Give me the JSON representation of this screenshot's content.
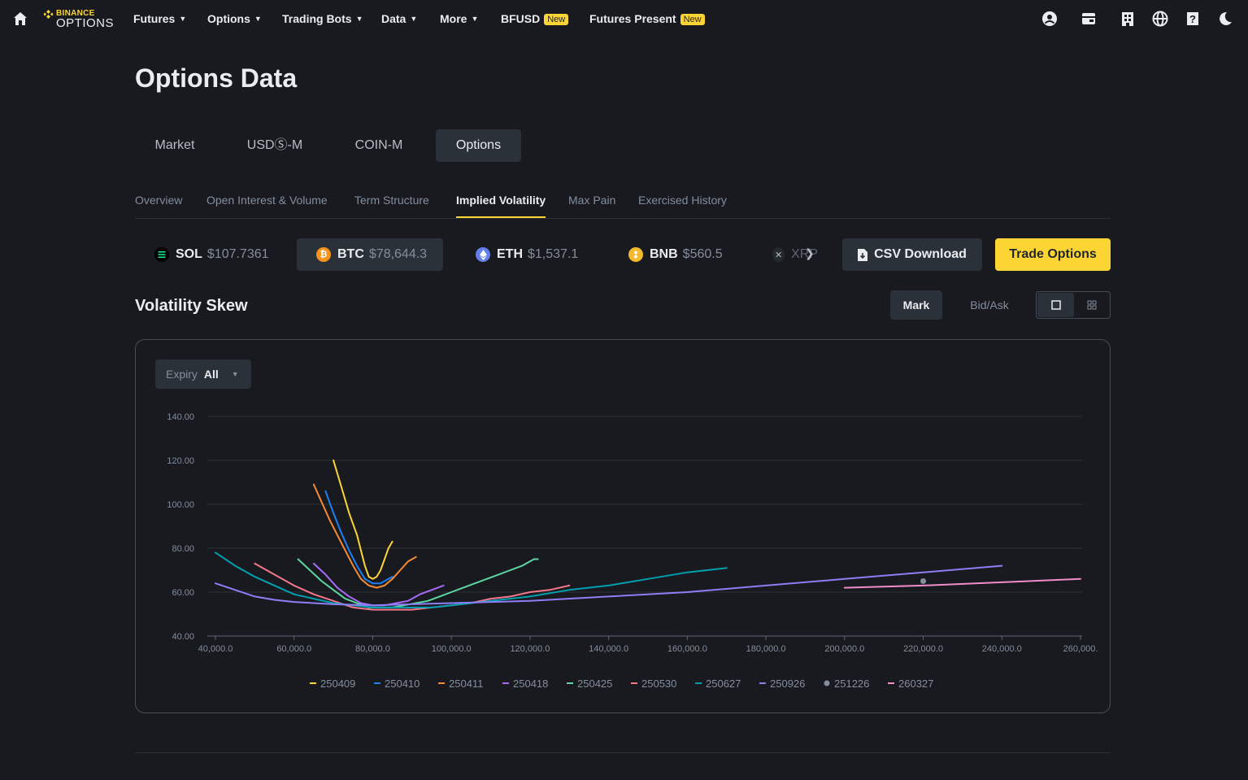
{
  "nav": {
    "logo_top": "BINANCE",
    "logo_bottom": "OPTIONS",
    "items": [
      {
        "label": "Futures",
        "dropdown": true,
        "badge": ""
      },
      {
        "label": "Options",
        "dropdown": true,
        "badge": ""
      },
      {
        "label": "Trading Bots",
        "dropdown": true,
        "badge": ""
      },
      {
        "label": "Data",
        "dropdown": true,
        "badge": ""
      },
      {
        "label": "More",
        "dropdown": true,
        "badge": ""
      },
      {
        "label": "BFUSD",
        "dropdown": false,
        "badge": "New"
      },
      {
        "label": "Futures Present",
        "dropdown": false,
        "badge": "New"
      }
    ],
    "right_icons": [
      "user-icon",
      "wallet-icon",
      "building-icon",
      "globe-icon",
      "help-icon",
      "moon-icon"
    ]
  },
  "page": {
    "title": "Options Data",
    "main_tabs": [
      "Market",
      "USDⓈ-M",
      "COIN-M",
      "Options"
    ],
    "active_main_tab": "Options",
    "sub_tabs": [
      "Overview",
      "Open Interest & Volume",
      "Term Structure",
      "Implied Volatility",
      "Max Pain",
      "Exercised History"
    ],
    "active_sub_tab": "Implied Volatility"
  },
  "coins": [
    {
      "symbol": "SOL",
      "price": "$107.7361",
      "color": "#000000"
    },
    {
      "symbol": "BTC",
      "price": "$78,644.3",
      "color": "#f7931a"
    },
    {
      "symbol": "ETH",
      "price": "$1,537.1",
      "color": "#627eea"
    },
    {
      "symbol": "BNB",
      "price": "$560.5",
      "color": "#f3ba2f"
    },
    {
      "symbol": "XRP",
      "price": "",
      "color": "#23292f"
    }
  ],
  "active_coin": "BTC",
  "actions": {
    "csv": "CSV Download",
    "trade": "Trade Options"
  },
  "section": {
    "title": "Volatility Skew",
    "mark_label": "Mark",
    "bidask_label": "Bid/Ask",
    "expiry_label": "Expiry",
    "expiry_value": "All"
  },
  "colors": {
    "accent": "#fcd535",
    "bg": "#181a20",
    "panel": "#2b3139",
    "muted": "#848e9c"
  },
  "chart_data": {
    "type": "line",
    "title": "",
    "xlabel": "",
    "ylabel": "",
    "xlim": [
      40000,
      260000
    ],
    "ylim": [
      40,
      140
    ],
    "x_ticks": [
      "40,000.0",
      "60,000.0",
      "80,000.0",
      "100,000.0",
      "120,000.0",
      "140,000.0",
      "160,000.0",
      "180,000.0",
      "200,000.0",
      "220,000.0",
      "240,000.0",
      "260,000."
    ],
    "y_ticks": [
      "40.00",
      "60.00",
      "80.00",
      "100.00",
      "120.00",
      "140.00"
    ],
    "grid": true,
    "legend_position": "bottom",
    "series": [
      {
        "name": "250409",
        "color": "#fcd535",
        "points": [
          [
            70000,
            120
          ],
          [
            72000,
            108
          ],
          [
            74000,
            96
          ],
          [
            76000,
            86
          ],
          [
            78000,
            72
          ],
          [
            79000,
            67
          ],
          [
            80000,
            66
          ],
          [
            81000,
            67
          ],
          [
            82000,
            70
          ],
          [
            83000,
            75
          ],
          [
            84000,
            80
          ],
          [
            85000,
            83
          ]
        ]
      },
      {
        "name": "250410",
        "color": "#1e80f0",
        "points": [
          [
            68000,
            106
          ],
          [
            70000,
            96
          ],
          [
            72000,
            87
          ],
          [
            74000,
            79
          ],
          [
            76000,
            72
          ],
          [
            78000,
            66
          ],
          [
            80000,
            64
          ],
          [
            82000,
            64
          ],
          [
            84000,
            66
          ],
          [
            85000,
            67
          ]
        ]
      },
      {
        "name": "250411",
        "color": "#f58a32",
        "points": [
          [
            65000,
            109
          ],
          [
            67000,
            101
          ],
          [
            69000,
            93
          ],
          [
            71000,
            86
          ],
          [
            73000,
            79
          ],
          [
            75000,
            72
          ],
          [
            77000,
            66
          ],
          [
            79000,
            63
          ],
          [
            81000,
            62
          ],
          [
            83000,
            63
          ],
          [
            85000,
            66
          ],
          [
            87000,
            70
          ],
          [
            89000,
            74
          ],
          [
            91000,
            76
          ]
        ]
      },
      {
        "name": "250418",
        "color": "#a66bf5",
        "points": [
          [
            65000,
            73
          ],
          [
            68000,
            68
          ],
          [
            71000,
            62
          ],
          [
            74000,
            58
          ],
          [
            77000,
            55
          ],
          [
            80000,
            54
          ],
          [
            83000,
            54
          ],
          [
            86000,
            55
          ],
          [
            89000,
            56
          ],
          [
            92000,
            59
          ],
          [
            95000,
            61
          ],
          [
            98000,
            63
          ]
        ]
      },
      {
        "name": "250425",
        "color": "#5ed6a1",
        "points": [
          [
            61000,
            75
          ],
          [
            64000,
            70
          ],
          [
            67000,
            65
          ],
          [
            70000,
            61
          ],
          [
            73000,
            57
          ],
          [
            76000,
            55
          ],
          [
            79000,
            53
          ],
          [
            82000,
            53
          ],
          [
            85000,
            53
          ],
          [
            88000,
            54
          ],
          [
            91000,
            55
          ],
          [
            94000,
            56
          ],
          [
            97000,
            58
          ],
          [
            100000,
            60
          ],
          [
            103000,
            62
          ],
          [
            106000,
            64
          ],
          [
            109000,
            66
          ],
          [
            112000,
            68
          ],
          [
            115000,
            70
          ],
          [
            118000,
            72
          ],
          [
            121000,
            75
          ],
          [
            122000,
            75
          ]
        ]
      },
      {
        "name": "250530",
        "color": "#f5778b",
        "points": [
          [
            50000,
            73
          ],
          [
            55000,
            68
          ],
          [
            60000,
            63
          ],
          [
            65000,
            59
          ],
          [
            70000,
            56
          ],
          [
            75000,
            53
          ],
          [
            80000,
            52
          ],
          [
            85000,
            52
          ],
          [
            90000,
            52
          ],
          [
            95000,
            53
          ],
          [
            100000,
            54
          ],
          [
            105000,
            55
          ],
          [
            110000,
            57
          ],
          [
            115000,
            58
          ],
          [
            120000,
            60
          ],
          [
            125000,
            61
          ],
          [
            130000,
            63
          ]
        ]
      },
      {
        "name": "250627",
        "color": "#00a0b0",
        "points": [
          [
            40000,
            78
          ],
          [
            45000,
            72
          ],
          [
            50000,
            67
          ],
          [
            55000,
            63
          ],
          [
            60000,
            59
          ],
          [
            65000,
            57
          ],
          [
            70000,
            55
          ],
          [
            75000,
            54
          ],
          [
            80000,
            53
          ],
          [
            85000,
            53
          ],
          [
            90000,
            53
          ],
          [
            95000,
            53
          ],
          [
            100000,
            54
          ],
          [
            110000,
            56
          ],
          [
            120000,
            58
          ],
          [
            130000,
            61
          ],
          [
            140000,
            63
          ],
          [
            150000,
            66
          ],
          [
            160000,
            69
          ],
          [
            170000,
            71
          ]
        ]
      },
      {
        "name": "250926",
        "color": "#8c7ff5",
        "points": [
          [
            40000,
            64
          ],
          [
            45000,
            61
          ],
          [
            50000,
            58
          ],
          [
            55000,
            56.5
          ],
          [
            60000,
            55.5
          ],
          [
            70000,
            54.5
          ],
          [
            80000,
            54
          ],
          [
            90000,
            54.5
          ],
          [
            100000,
            55
          ],
          [
            120000,
            56
          ],
          [
            140000,
            58
          ],
          [
            160000,
            60
          ],
          [
            180000,
            63
          ],
          [
            200000,
            66
          ],
          [
            220000,
            69
          ],
          [
            240000,
            72
          ]
        ]
      },
      {
        "name": "251226",
        "color": "#848e9c",
        "points": [
          [
            220000,
            65
          ]
        ]
      },
      {
        "name": "260327",
        "color": "#f08cc8",
        "points": [
          [
            200000,
            62
          ],
          [
            220000,
            63
          ],
          [
            240000,
            64.5
          ],
          [
            260000,
            66
          ]
        ]
      }
    ]
  }
}
